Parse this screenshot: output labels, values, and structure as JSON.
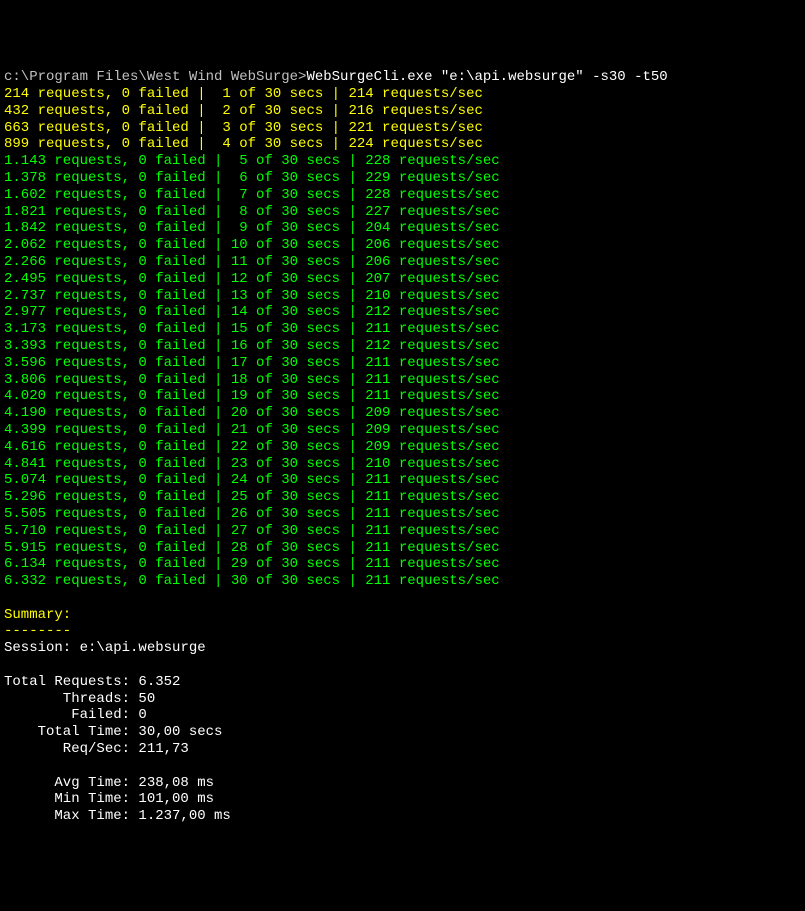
{
  "prompt": {
    "path": "c:\\Program Files\\West Wind WebSurge>",
    "command": "WebSurgeCli.exe \"e:\\api.websurge\" -s30 -t50"
  },
  "rows": [
    {
      "cls": "yellow",
      "rq": "214",
      "fl": "0",
      "sec": "1",
      "tot": "30",
      "rps": "214"
    },
    {
      "cls": "yellow",
      "rq": "432",
      "fl": "0",
      "sec": "2",
      "tot": "30",
      "rps": "216"
    },
    {
      "cls": "yellow",
      "rq": "663",
      "fl": "0",
      "sec": "3",
      "tot": "30",
      "rps": "221"
    },
    {
      "cls": "yellow",
      "rq": "899",
      "fl": "0",
      "sec": "4",
      "tot": "30",
      "rps": "224"
    },
    {
      "cls": "green",
      "rq": "1.143",
      "fl": "0",
      "sec": "5",
      "tot": "30",
      "rps": "228"
    },
    {
      "cls": "green",
      "rq": "1.378",
      "fl": "0",
      "sec": "6",
      "tot": "30",
      "rps": "229"
    },
    {
      "cls": "green",
      "rq": "1.602",
      "fl": "0",
      "sec": "7",
      "tot": "30",
      "rps": "228"
    },
    {
      "cls": "green",
      "rq": "1.821",
      "fl": "0",
      "sec": "8",
      "tot": "30",
      "rps": "227"
    },
    {
      "cls": "green",
      "rq": "1.842",
      "fl": "0",
      "sec": "9",
      "tot": "30",
      "rps": "204"
    },
    {
      "cls": "green",
      "rq": "2.062",
      "fl": "0",
      "sec": "10",
      "tot": "30",
      "rps": "206"
    },
    {
      "cls": "green",
      "rq": "2.266",
      "fl": "0",
      "sec": "11",
      "tot": "30",
      "rps": "206"
    },
    {
      "cls": "green",
      "rq": "2.495",
      "fl": "0",
      "sec": "12",
      "tot": "30",
      "rps": "207"
    },
    {
      "cls": "green",
      "rq": "2.737",
      "fl": "0",
      "sec": "13",
      "tot": "30",
      "rps": "210"
    },
    {
      "cls": "green",
      "rq": "2.977",
      "fl": "0",
      "sec": "14",
      "tot": "30",
      "rps": "212"
    },
    {
      "cls": "green",
      "rq": "3.173",
      "fl": "0",
      "sec": "15",
      "tot": "30",
      "rps": "211"
    },
    {
      "cls": "green",
      "rq": "3.393",
      "fl": "0",
      "sec": "16",
      "tot": "30",
      "rps": "212"
    },
    {
      "cls": "green",
      "rq": "3.596",
      "fl": "0",
      "sec": "17",
      "tot": "30",
      "rps": "211"
    },
    {
      "cls": "green",
      "rq": "3.806",
      "fl": "0",
      "sec": "18",
      "tot": "30",
      "rps": "211"
    },
    {
      "cls": "green",
      "rq": "4.020",
      "fl": "0",
      "sec": "19",
      "tot": "30",
      "rps": "211"
    },
    {
      "cls": "green",
      "rq": "4.190",
      "fl": "0",
      "sec": "20",
      "tot": "30",
      "rps": "209"
    },
    {
      "cls": "green",
      "rq": "4.399",
      "fl": "0",
      "sec": "21",
      "tot": "30",
      "rps": "209"
    },
    {
      "cls": "green",
      "rq": "4.616",
      "fl": "0",
      "sec": "22",
      "tot": "30",
      "rps": "209"
    },
    {
      "cls": "green",
      "rq": "4.841",
      "fl": "0",
      "sec": "23",
      "tot": "30",
      "rps": "210"
    },
    {
      "cls": "green",
      "rq": "5.074",
      "fl": "0",
      "sec": "24",
      "tot": "30",
      "rps": "211"
    },
    {
      "cls": "green",
      "rq": "5.296",
      "fl": "0",
      "sec": "25",
      "tot": "30",
      "rps": "211"
    },
    {
      "cls": "green",
      "rq": "5.505",
      "fl": "0",
      "sec": "26",
      "tot": "30",
      "rps": "211"
    },
    {
      "cls": "green",
      "rq": "5.710",
      "fl": "0",
      "sec": "27",
      "tot": "30",
      "rps": "211"
    },
    {
      "cls": "green",
      "rq": "5.915",
      "fl": "0",
      "sec": "28",
      "tot": "30",
      "rps": "211"
    },
    {
      "cls": "green",
      "rq": "6.134",
      "fl": "0",
      "sec": "29",
      "tot": "30",
      "rps": "211"
    },
    {
      "cls": "green",
      "rq": "6.332",
      "fl": "0",
      "sec": "30",
      "tot": "30",
      "rps": "211"
    }
  ],
  "summary": {
    "heading": "Summary:",
    "divider": "--------",
    "session_label": "Session: ",
    "session_value": "e:\\api.websurge",
    "total_requests_label": "Total Requests: ",
    "total_requests_value": "6.352",
    "threads_label": "       Threads: ",
    "threads_value": "50",
    "failed_label": "        Failed: ",
    "failed_value": "0",
    "total_time_label": "    Total Time: ",
    "total_time_value": "30,00 secs",
    "req_sec_label": "       Req/Sec: ",
    "req_sec_value": "211,73",
    "avg_time_label": "      Avg Time: ",
    "avg_time_value": "238,08 ms",
    "min_time_label": "      Min Time: ",
    "min_time_value": "101,00 ms",
    "max_time_label": "      Max Time: ",
    "max_time_value": "1.237,00 ms"
  }
}
